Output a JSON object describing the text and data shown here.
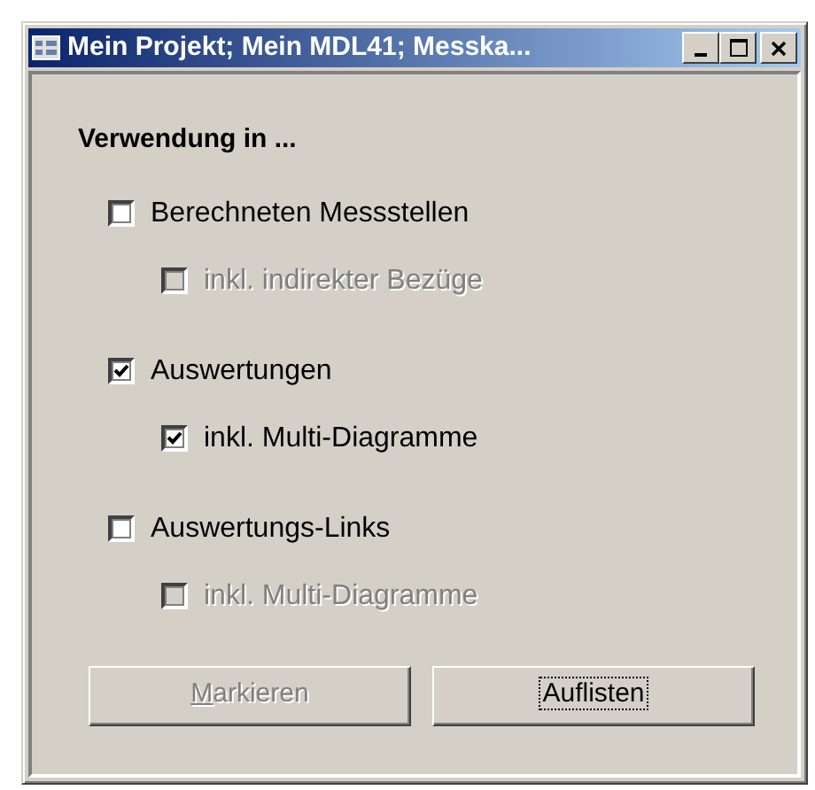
{
  "window": {
    "title": "Mein Projekt; Mein MDL41; Messka...",
    "controls": [
      {
        "kind": "minimize"
      },
      {
        "kind": "maximize"
      },
      {
        "kind": "close"
      }
    ]
  },
  "heading": "Verwendung in ...",
  "groups": [
    {
      "label": "Berechneten Messstellen",
      "checked": false,
      "disabled": false,
      "sub": {
        "label": "inkl. indirekter Bezüge",
        "checked": false,
        "disabled": true
      }
    },
    {
      "label": "Auswertungen",
      "checked": true,
      "disabled": false,
      "sub": {
        "label": "inkl. Multi-Diagramme",
        "checked": true,
        "disabled": false
      }
    },
    {
      "label": "Auswertungs-Links",
      "checked": false,
      "disabled": false,
      "sub": {
        "label": "inkl. Multi-Diagramme",
        "checked": false,
        "disabled": true
      }
    }
  ],
  "buttons": [
    {
      "label": "Markieren",
      "disabled": true,
      "mnemonic_first_letter": true,
      "focused": false
    },
    {
      "label": "Auflisten",
      "disabled": false,
      "mnemonic_first_letter": false,
      "focused": true
    }
  ]
}
